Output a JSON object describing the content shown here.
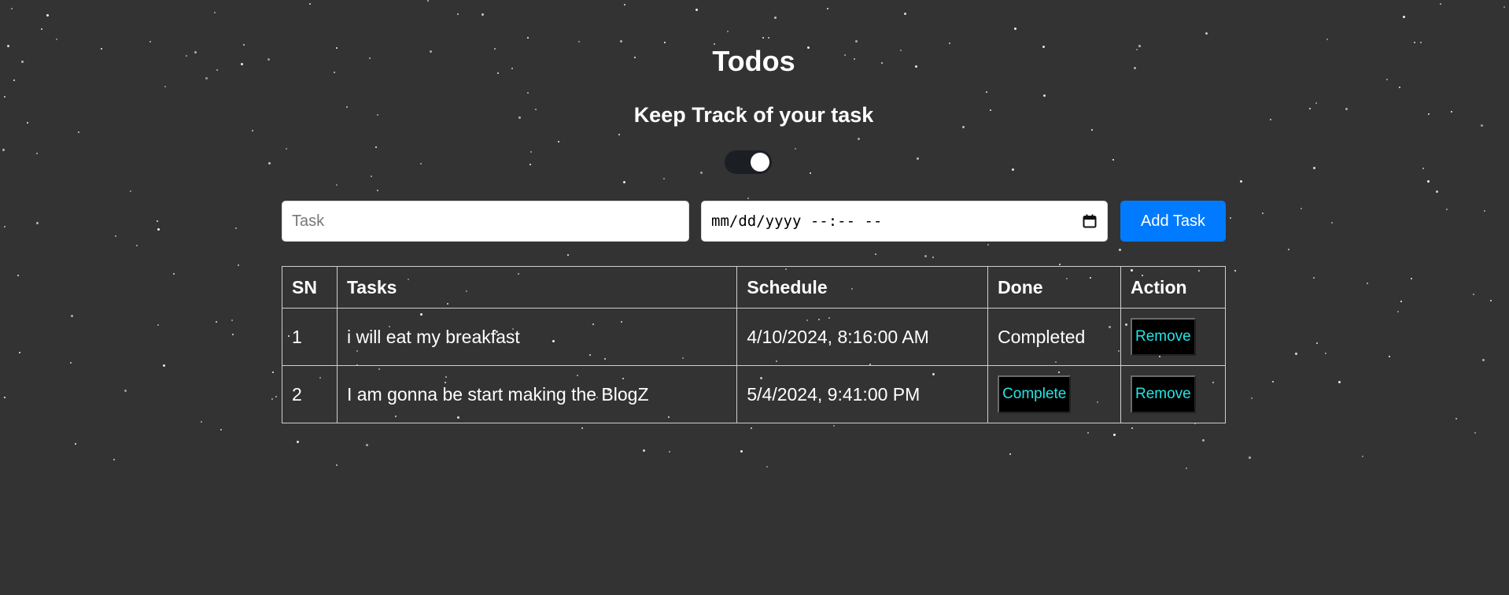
{
  "header": {
    "title": "Todos",
    "subtitle": "Keep Track of your task"
  },
  "theme_toggle": {
    "state": "on"
  },
  "form": {
    "task_placeholder": "Task",
    "task_value": "",
    "schedule_placeholder": "mm/dd/yyyy --:-- --",
    "add_button_label": "Add Task"
  },
  "table": {
    "headers": {
      "sn": "SN",
      "tasks": "Tasks",
      "schedule": "Schedule",
      "done": "Done",
      "action": "Action"
    },
    "rows": [
      {
        "sn": "1",
        "task": "i will eat my breakfast",
        "schedule": "4/10/2024, 8:16:00 AM",
        "done": "Completed",
        "action": "Remove"
      },
      {
        "sn": "2",
        "task": "I am gonna be start making the BlogZ",
        "schedule": "5/4/2024, 9:41:00 PM",
        "done_button": "Complete",
        "action": "Remove"
      }
    ]
  },
  "colors": {
    "background": "#333333",
    "primary_button": "#007bff",
    "cell_button_text": "#22e6e6",
    "cell_button_bg": "#000000"
  }
}
